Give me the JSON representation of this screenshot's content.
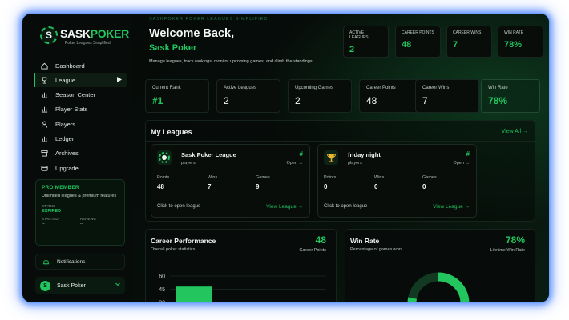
{
  "brand": {
    "badge_letter": "S",
    "name_part1": "SASK",
    "name_part2": "POKER",
    "tagline": "Poker Leagues Simplified",
    "header_tagline": "SASKPOKER POKER LEAGUES SIMPLIFIED"
  },
  "nav": [
    {
      "label": "Dashboard",
      "icon": "home-icon"
    },
    {
      "label": "League",
      "icon": "trophy-icon",
      "active": true
    },
    {
      "label": "Season Center",
      "icon": "bar-chart-icon"
    },
    {
      "label": "Player Stats",
      "icon": "bar-chart-icon"
    },
    {
      "label": "Players",
      "icon": "user-icon"
    },
    {
      "label": "Ledger",
      "icon": "bar-chart-icon"
    },
    {
      "label": "Archives",
      "icon": "archive-icon"
    },
    {
      "label": "Upgrade",
      "icon": "card-icon"
    }
  ],
  "pro": {
    "title": "PRO MEMBER",
    "description": "Unlimited leagues & premium features",
    "status_label": "STATUS",
    "status": "EXPIRED",
    "started_label": "STARTED",
    "started": "--",
    "renews_label": "RENEWS",
    "renews": "--"
  },
  "notifications_label": "Notifications",
  "user": {
    "initial": "S",
    "name": "Sask Poker"
  },
  "header": {
    "welcome": "Welcome Back,",
    "name": "Sask Poker",
    "subtitle": "Manage leagues, track rankings, monitor upcoming games, and climb the standings."
  },
  "mini_stats": [
    {
      "label": "ACTIVE LEAGUES",
      "value": "2"
    },
    {
      "label": "CAREER POINTS",
      "value": "48"
    },
    {
      "label": "CAREER WINS",
      "value": "7"
    },
    {
      "label": "WIN RATE",
      "value": "78%"
    }
  ],
  "stats": [
    {
      "label": "Current Rank",
      "value": "#1"
    },
    {
      "label": "Active Leagues",
      "value": "2"
    },
    {
      "label": "Upcoming Games",
      "value": "2"
    },
    {
      "label": "Career Points",
      "value": "48"
    },
    {
      "label": "Career Wins",
      "value": "7"
    },
    {
      "label": "Win Rate",
      "value": "78%"
    }
  ],
  "my_leagues": {
    "title": "My Leagues",
    "view_all": "View All →",
    "leagues": [
      {
        "name": "Sask Poker League",
        "subtitle": "players",
        "hash": "#",
        "open": "Open →",
        "icon": "chip-icon",
        "points_label": "Points",
        "points": "48",
        "wins_label": "Wins",
        "wins": "7",
        "games_label": "Games",
        "games": "9",
        "click_text": "Click to open league",
        "view_text": "View League →"
      },
      {
        "name": "friday night",
        "subtitle": "players",
        "hash": "#",
        "open": "Open →",
        "icon": "trophy-icon",
        "points_label": "Points",
        "points": "0",
        "wins_label": "Wins",
        "wins": "0",
        "games_label": "Games",
        "games": "0",
        "click_text": "Click to open league",
        "view_text": "View League →"
      }
    ]
  },
  "career_performance": {
    "title": "Career Performance",
    "subtitle": "Overall poker statistics",
    "value": "48",
    "caption": "Career Points"
  },
  "win_rate_panel": {
    "title": "Win Rate",
    "subtitle": "Percentage of games won",
    "value": "78%",
    "caption": "Lifetime Win Rate",
    "fraction": 0.78
  },
  "chart_data": {
    "type": "bar",
    "categories": [
      ""
    ],
    "values": [
      48
    ],
    "y_ticks": [
      60,
      45,
      30
    ],
    "ylim": [
      0,
      60
    ]
  },
  "colors": {
    "accent": "#22c55e",
    "background": "#050807",
    "frame_glow": "#6fa0ff"
  }
}
